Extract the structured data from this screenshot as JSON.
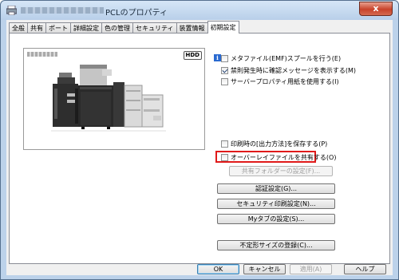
{
  "window": {
    "title_suffix": "PCLのプロパティ",
    "close_label": "x"
  },
  "tabs": [
    {
      "label": "全般",
      "active": false
    },
    {
      "label": "共有",
      "active": false
    },
    {
      "label": "ポート",
      "active": false
    },
    {
      "label": "詳細設定",
      "active": false
    },
    {
      "label": "色の管理",
      "active": false
    },
    {
      "label": "セキュリティ",
      "active": false
    },
    {
      "label": "装置情報",
      "active": false
    },
    {
      "label": "初期設定",
      "active": true
    }
  ],
  "preview": {
    "badge": "HDD",
    "icon": "printer-image"
  },
  "options": {
    "emf_spool": {
      "label": "メタファイル(EMF)スプールを行う(E)",
      "checked": false
    },
    "confirm_restrict": {
      "label": "禁則発生時に確認メッセージを表示する(M)",
      "checked": true
    },
    "server_paper": {
      "label": "サーバープロパティ用紙を使用する(I)",
      "checked": false
    },
    "save_output_method": {
      "label": "印刷時の[出力方法]を保存する(P)",
      "checked": false
    },
    "share_overlay": {
      "label": "オーバーレイファイルを共有する(O)",
      "checked": false
    }
  },
  "buttons": {
    "shared_folder": "共有フォルダーの設定(F)...",
    "auth_settings": "認証設定(G)...",
    "secure_print": "セキュリティ印刷設定(N)...",
    "my_tab": "Myタブの設定(S)...",
    "custom_size": "不定形サイズの登録(C)..."
  },
  "footer": {
    "ok": "OK",
    "cancel": "キャンセル",
    "apply": "適用(A)",
    "help": "ヘルプ"
  },
  "colors": {
    "highlight": "#e01a1a",
    "titlebar": "#bcd2ea"
  }
}
